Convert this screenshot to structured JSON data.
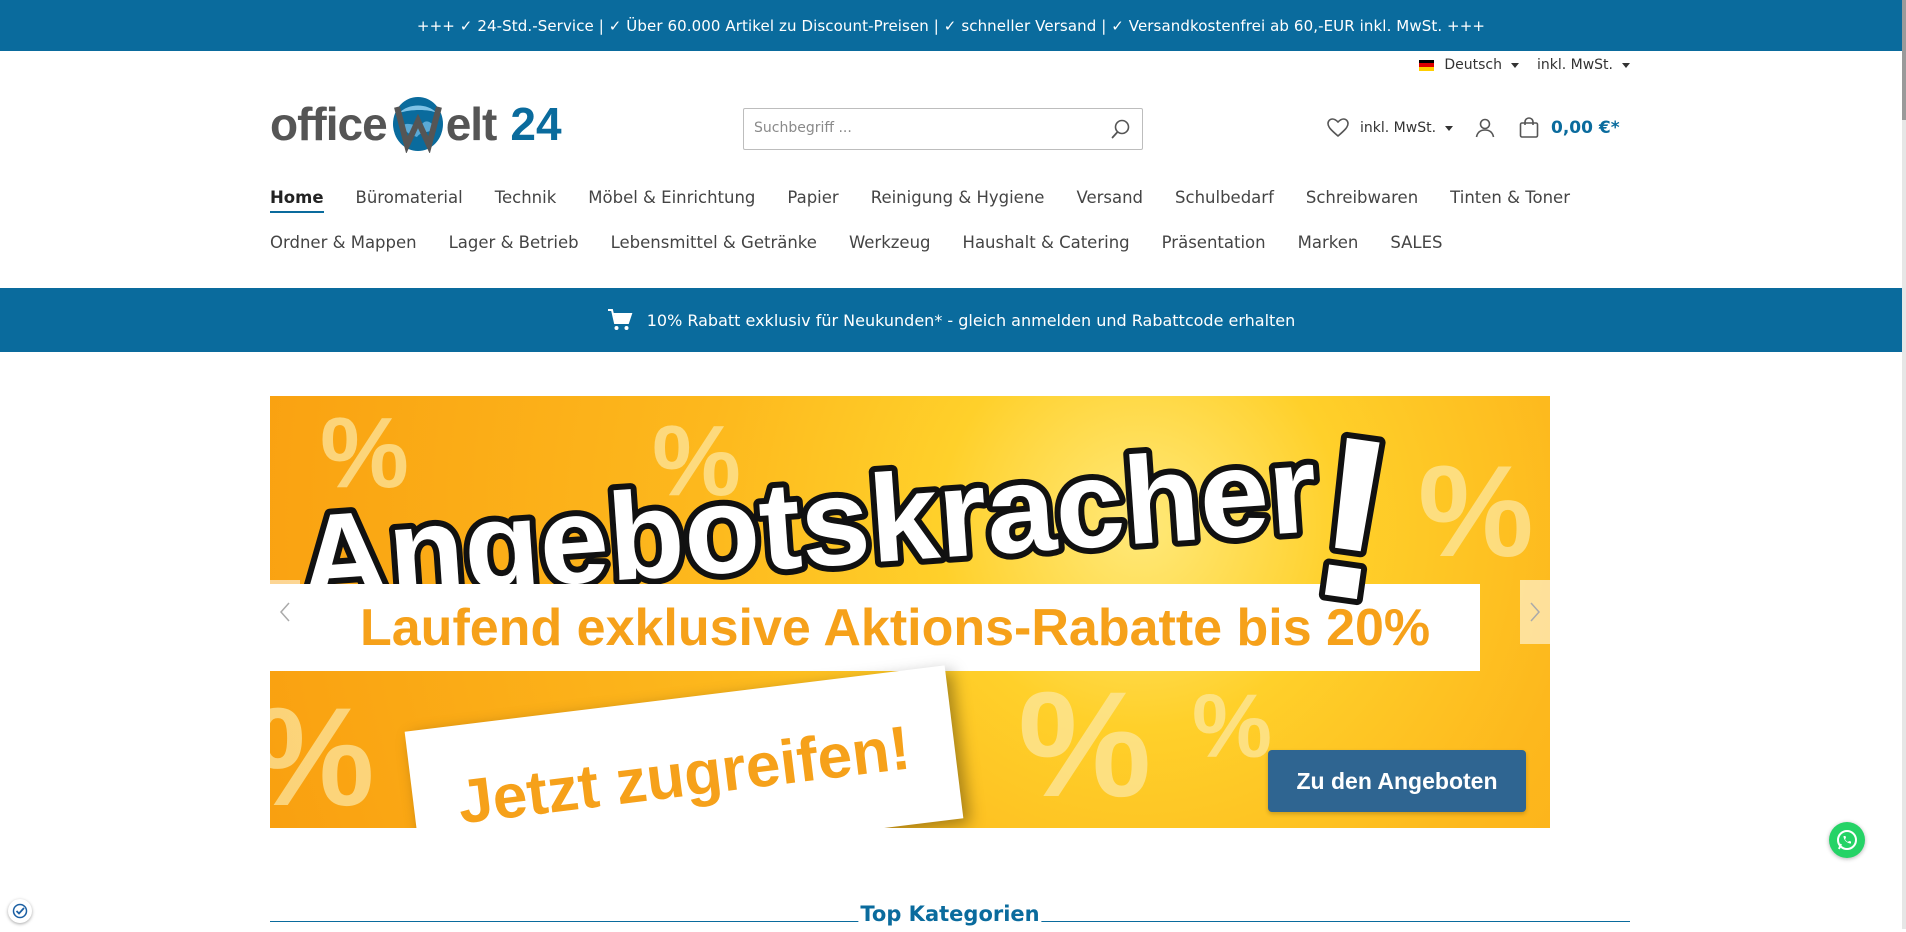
{
  "topbar": {
    "text": "+++ ✓ 24-Std.-Service | ✓ Über 60.000 Artikel zu Discount-Preisen | ✓ schneller Versand | ✓ Versandkostenfrei ab 60,-EUR inkl. MwSt. +++"
  },
  "lang": {
    "language": "Deutsch",
    "tax": "inkl. MwSt."
  },
  "logo": {
    "part1": "office",
    "part2": "elt",
    "number": "24"
  },
  "search": {
    "placeholder": "Suchbegriff ..."
  },
  "header": {
    "tax_label": "inkl. MwSt.",
    "cart_total": "0,00 €*"
  },
  "nav": {
    "row1": [
      "Home",
      "Büromaterial",
      "Technik",
      "Möbel & Einrichtung",
      "Papier",
      "Reinigung & Hygiene",
      "Versand",
      "Schulbedarf",
      "Schreibwaren",
      "Tinten & Toner"
    ],
    "row2": [
      "Ordner & Mappen",
      "Lager & Betrieb",
      "Lebensmittel & Getränke",
      "Werkzeug",
      "Haushalt & Catering",
      "Präsentation",
      "Marken",
      "SALES"
    ]
  },
  "promo": {
    "text": "10% Rabatt exklusiv für Neukunden* - gleich anmelden und Rabattcode erhalten"
  },
  "banner": {
    "headline": "Angebotskracher",
    "exclaim": "!",
    "subline": "Laufend exklusive Aktions-Rabatte bis 20%",
    "grab": "Jetzt zugreifen!",
    "cta": "Zu den Angeboten",
    "percent": "%"
  },
  "section": {
    "title": "Top Kategorien"
  },
  "colors": {
    "brand": "#0a6b9d",
    "banner_orange": "#f6a11a",
    "cta": "#2f6591",
    "whatsapp": "#25d366"
  }
}
